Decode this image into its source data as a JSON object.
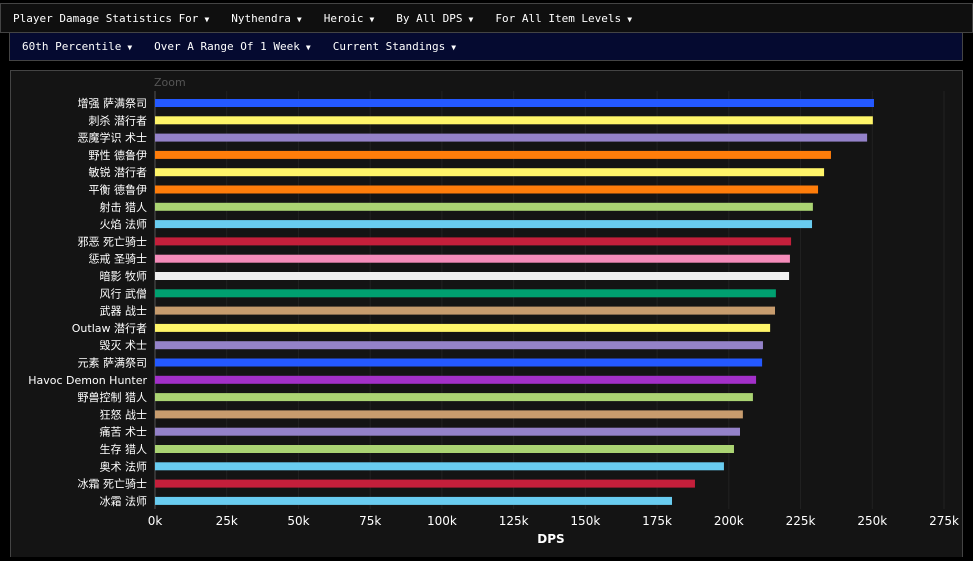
{
  "toolbar1": [
    {
      "label": "Player Damage Statistics For"
    },
    {
      "label": "Nythendra"
    },
    {
      "label": "Heroic"
    },
    {
      "label": "By All DPS"
    },
    {
      "label": "For All Item Levels"
    }
  ],
  "toolbar2": [
    {
      "label": "60th Percentile"
    },
    {
      "label": "Over A Range Of 1 Week"
    },
    {
      "label": "Current Standings"
    }
  ],
  "chart_data": {
    "type": "bar",
    "orientation": "horizontal",
    "zoom_label": "Zoom",
    "xlabel": "DPS",
    "xlim": [
      0,
      275000
    ],
    "xticks": [
      0,
      25000,
      50000,
      75000,
      100000,
      125000,
      150000,
      175000,
      200000,
      225000,
      250000,
      275000
    ],
    "xtick_labels": [
      "0k",
      "25k",
      "50k",
      "75k",
      "100k",
      "125k",
      "150k",
      "175k",
      "200k",
      "225k",
      "250k",
      "275k"
    ],
    "grid": true,
    "categories": [
      "增强 萨满祭司",
      "刺杀 潜行者",
      "恶魔学识 术士",
      "野性 德鲁伊",
      "敏锐 潜行者",
      "平衡 德鲁伊",
      "射击 猎人",
      "火焰 法师",
      "邪恶 死亡骑士",
      "惩戒 圣骑士",
      "暗影 牧师",
      "风行 武僧",
      "武器 战士",
      "Outlaw 潜行者",
      "毁灭 术士",
      "元素 萨满祭司",
      "Havoc Demon Hunter",
      "野兽控制 猎人",
      "狂怒 战士",
      "痛苦 术士",
      "生存 猎人",
      "奥术 法师",
      "冰霜 死亡骑士",
      "冰霜 法师"
    ],
    "values": [
      250600,
      250200,
      248200,
      235600,
      233200,
      231100,
      229300,
      229000,
      221700,
      221300,
      221000,
      216400,
      216100,
      214400,
      211900,
      211600,
      209500,
      208400,
      204900,
      203900,
      201800,
      198300,
      188200,
      180200
    ],
    "colors": [
      "#2459ff",
      "#fff569",
      "#9482c9",
      "#ff7d0a",
      "#fff569",
      "#ff7d0a",
      "#abd473",
      "#69ccf0",
      "#c41f3b",
      "#f58cba",
      "#f0f0f0",
      "#00a070",
      "#c79c6e",
      "#fff569",
      "#9482c9",
      "#2459ff",
      "#a330c9",
      "#abd473",
      "#c79c6e",
      "#9482c9",
      "#abd473",
      "#69ccf0",
      "#c41f3b",
      "#69ccf0"
    ]
  }
}
